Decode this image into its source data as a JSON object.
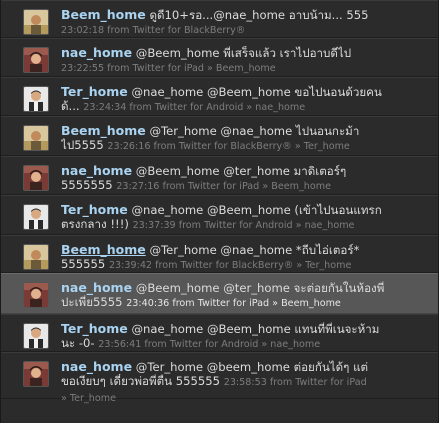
{
  "tweets": [
    {
      "avatar": "beem",
      "user": "Beem_home",
      "line1": "ดูดี10+รอ...@nae_home อาบน้าม... 555",
      "line2": "",
      "meta": "23:02:18 from Twitter for BlackBerry®"
    },
    {
      "avatar": "nae",
      "user": "nae_home",
      "line1": "@Beem_home พี่เสร็จแล้ว เราไปอาบดีไป",
      "line2": "",
      "meta": "23:22:55 from Twitter for iPad » Beem_home"
    },
    {
      "avatar": "ter",
      "user": "Ter_home",
      "line1": "@nae_home @Beem_home ขอไปนอนด้วยคน",
      "line2": "ด้...",
      "meta": "23:24:34 from Twitter for Android » nae_home"
    },
    {
      "avatar": "beem",
      "user": "Beem_home",
      "line1": "@Ter_home @nae_home ไปนอนกะม้า",
      "line2": "ไป5555",
      "meta": "23:26:16 from Twitter for BlackBerry® » Ter_home"
    },
    {
      "avatar": "nae",
      "user": "nae_home",
      "line1": "@Beem_home @ter_home มาดิเตอร์ๆ",
      "line2": "5555555",
      "meta": "23:27:16 from Twitter for iPad » Beem_home"
    },
    {
      "avatar": "ter",
      "user": "Ter_home",
      "line1": "@nae_home @Beem_home (เข้าไปนอนแทรก",
      "line2": "ตรงกลาง !!!)",
      "meta": "23:37:39 from Twitter for Android » nae_home"
    },
    {
      "avatar": "beem",
      "user": "Beem_home",
      "line1": "@Ter_home @nae_home *ถีบไอ่เตอร์*",
      "line2": "555555",
      "meta": "23:39:42 from Twitter for BlackBerry® » Ter_home"
    },
    {
      "avatar": "nae",
      "user": "nae_home",
      "line1": "@Beem_home @ter_home จะต่อยกันในห้องพี่",
      "line2": "ปะเพี่ย5555",
      "meta": "23:40:36 from Twitter for iPad » Beem_home"
    },
    {
      "avatar": "ter",
      "user": "Ter_home",
      "line1": "@nae_home @Beem_home แทนที่พี่เนจะห้าม",
      "line2": "นะ -0-",
      "meta": "23:56:41 from Twitter for Android » nae_home"
    },
    {
      "avatar": "nae",
      "user": "nae_home",
      "line1": "@Ter_home @beem_home ต่อยกันได้ๆ แต่",
      "line2": "ขอเงียบๆ เดี๋ยวพ่อพี่ตื่น 555555",
      "meta": "23:58:53 from Twitter for iPad",
      "line3": "» Ter_home"
    }
  ]
}
